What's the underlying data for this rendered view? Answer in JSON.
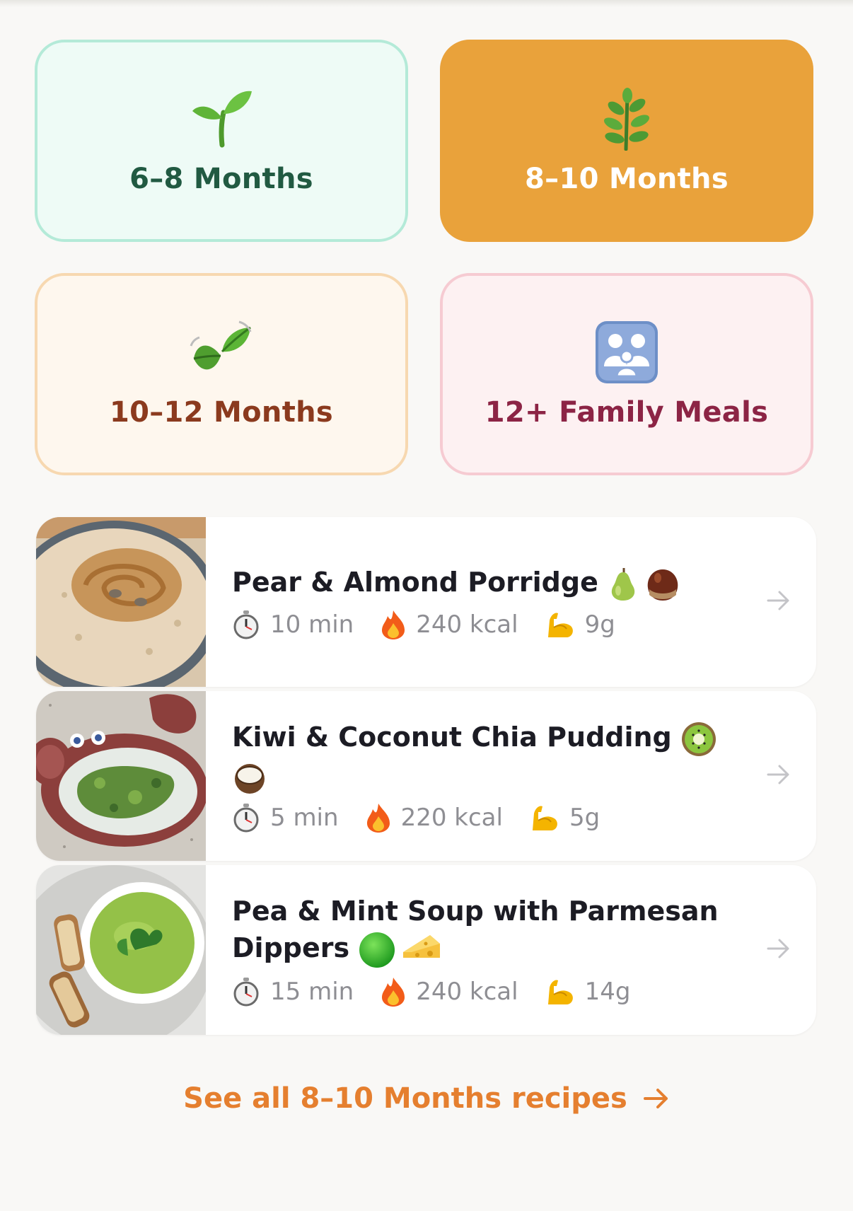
{
  "age_tiles": [
    {
      "label": "6–8 Months",
      "icon": "sprout-icon"
    },
    {
      "label": "8–10 Months",
      "icon": "herb-icon",
      "selected": true
    },
    {
      "label": "10–12 Months",
      "icon": "leaves-icon"
    },
    {
      "label": "12+ Family Meals",
      "icon": "family-icon"
    }
  ],
  "recipes": [
    {
      "title": "Pear & Almond Porridge",
      "emojis": [
        "pear-icon",
        "chestnut-icon"
      ],
      "time": "10 min",
      "kcal": "240 kcal",
      "protein": "9g",
      "thumb": "porridge-photo"
    },
    {
      "title": "Kiwi & Coconut Chia Pudding",
      "emojis": [
        "kiwi-icon",
        "coconut-icon"
      ],
      "time": "5 min",
      "kcal": "220 kcal",
      "protein": "5g",
      "thumb": "chia-pudding-photo"
    },
    {
      "title": "Pea & Mint Soup with Parmesan Dippers",
      "emojis": [
        "green-circle-icon",
        "cheese-icon"
      ],
      "time": "15 min",
      "kcal": "240 kcal",
      "protein": "14g",
      "thumb": "pea-soup-photo"
    }
  ],
  "see_all": {
    "label": "See all 8–10 Months recipes"
  },
  "colors": {
    "accent": "#e9a23b",
    "link": "#e57f2f",
    "meta_text": "#8e8e93"
  }
}
